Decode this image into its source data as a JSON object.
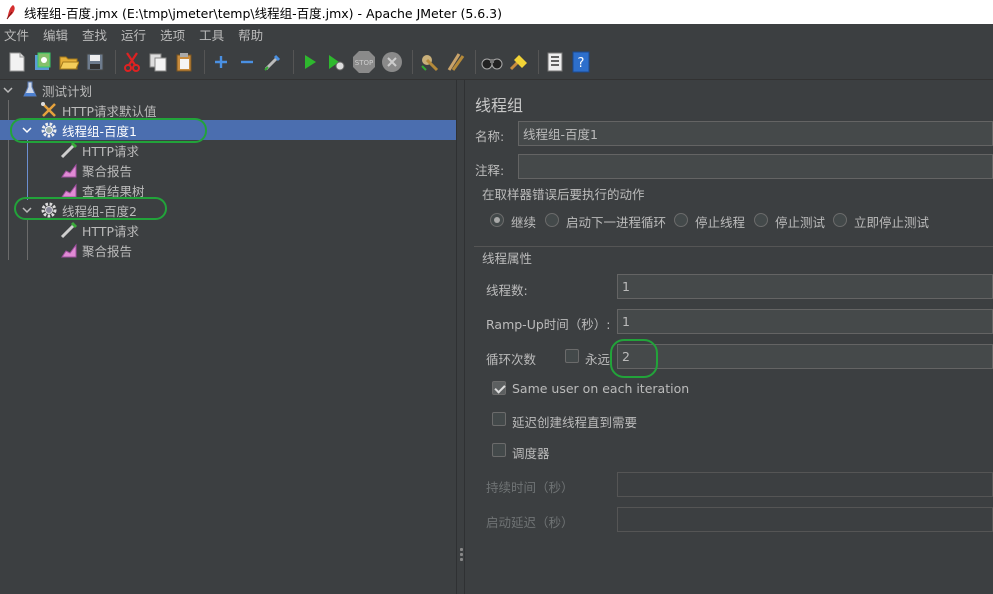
{
  "window": {
    "title": "线程组-百度.jmx (E:\\tmp\\jmeter\\temp\\线程组-百度.jmx) - Apache JMeter (5.6.3)"
  },
  "menu": [
    "文件",
    "编辑",
    "查找",
    "运行",
    "选项",
    "工具",
    "帮助"
  ],
  "toolbar_icons": [
    "new-icon",
    "templates-icon",
    "open-icon",
    "save-icon",
    "cut-icon",
    "copy-icon",
    "paste-icon",
    "expand-icon",
    "collapse-icon",
    "toggle-icon",
    "start-icon",
    "start-no-pause-icon",
    "stop-icon",
    "shutdown-icon",
    "clear-icon",
    "clear-all-icon",
    "search-icon",
    "reset-search-icon",
    "function-helper-icon",
    "help-icon"
  ],
  "tree": {
    "test_plan": "测试计划",
    "http_defaults": "HTTP请求默认值",
    "group1": "线程组-百度1",
    "g1_http": "HTTP请求",
    "g1_report": "聚合报告",
    "g1_tree": "查看结果树",
    "group2": "线程组-百度2",
    "g2_http": "HTTP请求",
    "g2_report": "聚合报告"
  },
  "panel": {
    "heading": "线程组",
    "name_label": "名称:",
    "name_value": "线程组-百度1",
    "comment_label": "注释:",
    "comment_value": "",
    "error_action_title": "在取样器错误后要执行的动作",
    "error_actions": [
      "继续",
      "启动下一进程循环",
      "停止线程",
      "停止测试",
      "立即停止测试"
    ],
    "error_action_selected": "继续",
    "thread_props_title": "线程属性",
    "threads_label": "线程数:",
    "threads_value": "1",
    "rampup_label": "Ramp-Up时间（秒）:",
    "rampup_value": "1",
    "loop_label": "循环次数",
    "forever_label": "永远",
    "forever_checked": false,
    "loop_value": "2",
    "same_user_label": "Same user on each iteration",
    "same_user_checked": true,
    "delay_label": "延迟创建线程直到需要",
    "delay_checked": false,
    "scheduler_label": "调度器",
    "scheduler_checked": false,
    "duration_label": "持续时间（秒）",
    "duration_value": "",
    "startup_delay_label": "启动延迟（秒）",
    "startup_delay_value": ""
  },
  "colors": {
    "background": "#3c3f41",
    "selection": "#4b6eaf",
    "annotation": "#22a33a"
  }
}
